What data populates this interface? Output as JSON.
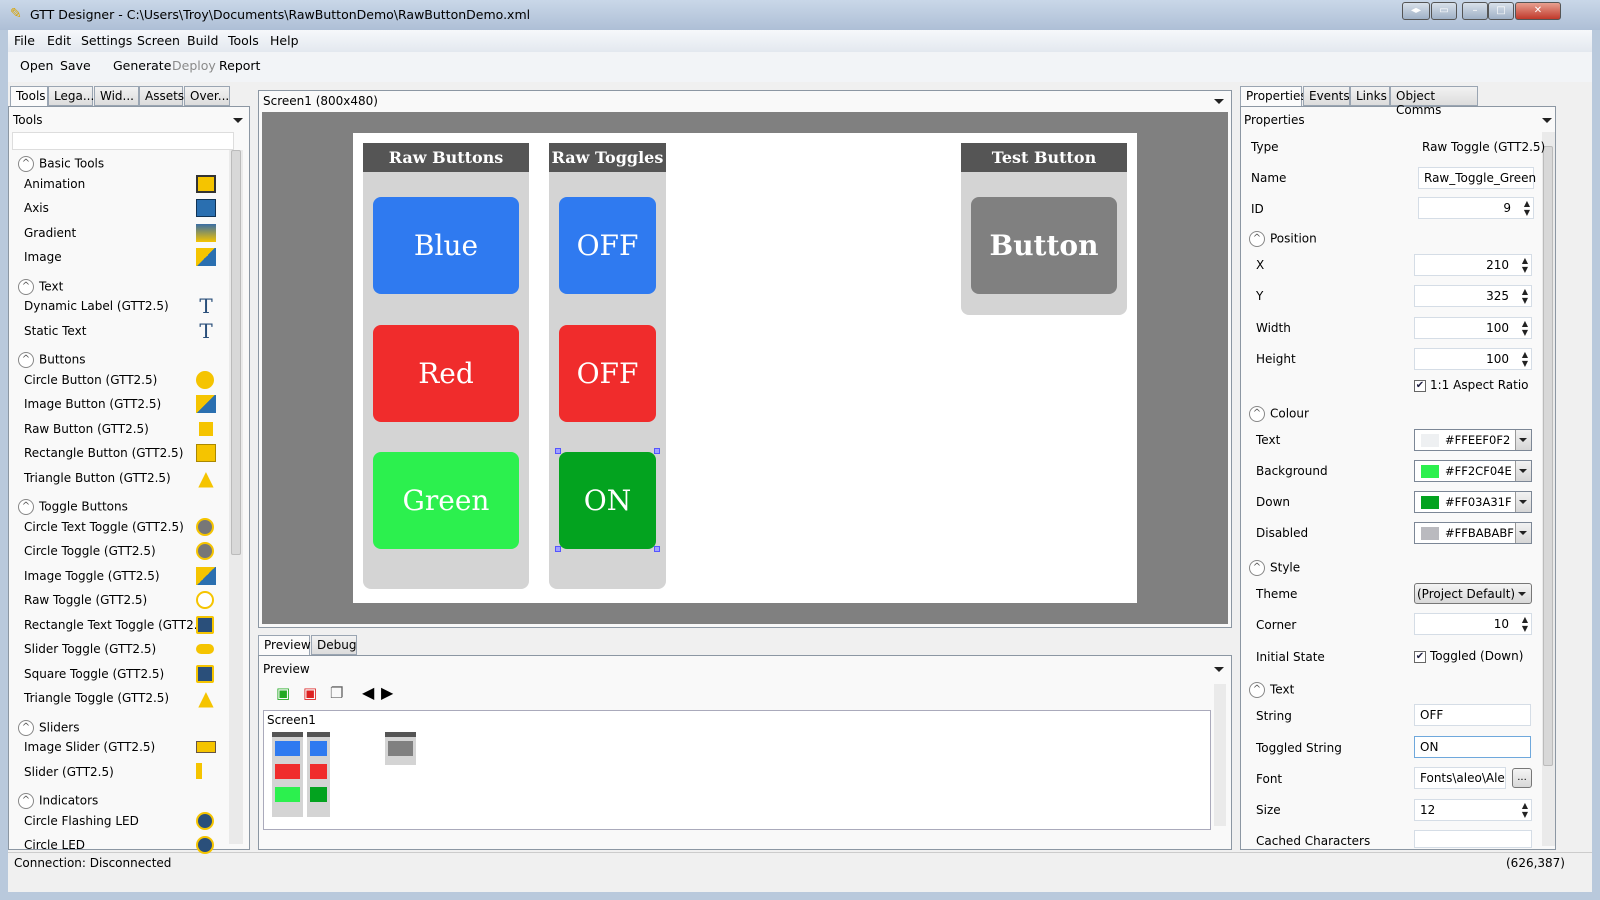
{
  "window": {
    "title": "GTT Designer - C:\\Users\\Troy\\Documents\\RawButtonDemo\\RawButtonDemo.xml"
  },
  "menu": [
    "File",
    "Edit",
    "Settings",
    "Screen",
    "Build",
    "Tools",
    "Help"
  ],
  "toolbar": {
    "open": "Open",
    "save": "Save",
    "generate": "Generate",
    "deploy": "Deploy",
    "report": "Report"
  },
  "left": {
    "tabs": [
      "Tools",
      "Lega...",
      "Wid...",
      "Assets",
      "Over..."
    ],
    "dropdown": "Tools",
    "groups": [
      {
        "label": "Basic Tools",
        "items": [
          {
            "label": "Animation",
            "icon": "animation-icon"
          },
          {
            "label": "Axis",
            "icon": "axis-icon"
          },
          {
            "label": "Gradient",
            "icon": "gradient-icon"
          },
          {
            "label": "Image",
            "icon": "image-icon"
          }
        ]
      },
      {
        "label": "Text",
        "items": [
          {
            "label": "Dynamic Label (GTT2.5)",
            "icon": "dynamic-text-icon"
          },
          {
            "label": "Static Text",
            "icon": "static-text-icon"
          }
        ]
      },
      {
        "label": "Buttons",
        "items": [
          {
            "label": "Circle Button (GTT2.5)",
            "icon": "circle-icon"
          },
          {
            "label": "Image Button (GTT2.5)",
            "icon": "image-icon"
          },
          {
            "label": "Raw Button (GTT2.5)",
            "icon": "raw-button-icon"
          },
          {
            "label": "Rectangle Button (GTT2.5)",
            "icon": "rectangle-icon"
          },
          {
            "label": "Triangle Button (GTT2.5)",
            "icon": "triangle-icon"
          }
        ]
      },
      {
        "label": "Toggle Buttons",
        "items": [
          {
            "label": "Circle Text Toggle (GTT2.5)",
            "icon": "circle-text-toggle-icon"
          },
          {
            "label": "Circle Toggle (GTT2.5)",
            "icon": "circle-toggle-icon"
          },
          {
            "label": "Image Toggle (GTT2.5)",
            "icon": "image-icon"
          },
          {
            "label": "Raw Toggle (GTT2.5)",
            "icon": "raw-toggle-icon"
          },
          {
            "label": "Rectangle Text Toggle (GTT2.5)",
            "icon": "rect-text-toggle-icon"
          },
          {
            "label": "Slider Toggle (GTT2.5)",
            "icon": "slider-toggle-icon"
          },
          {
            "label": "Square Toggle (GTT2.5)",
            "icon": "square-toggle-icon"
          },
          {
            "label": "Triangle Toggle (GTT2.5)",
            "icon": "triangle-toggle-icon"
          }
        ]
      },
      {
        "label": "Sliders",
        "items": [
          {
            "label": "Image Slider (GTT2.5)",
            "icon": "image-slider-icon"
          },
          {
            "label": "Slider (GTT2.5)",
            "icon": "slider-icon"
          }
        ]
      },
      {
        "label": "Indicators",
        "items": [
          {
            "label": "Circle Flashing LED",
            "icon": "flashing-led-icon"
          },
          {
            "label": "Circle LED",
            "icon": "led-icon"
          }
        ]
      }
    ]
  },
  "screen": {
    "title": "Screen1 (800x480)",
    "raw_buttons": {
      "header": "Raw Buttons",
      "buttons": [
        {
          "label": "Blue",
          "color": "#2F7AF0"
        },
        {
          "label": "Red",
          "color": "#F02C2C"
        },
        {
          "label": "Green",
          "color": "#2CF04E"
        }
      ]
    },
    "raw_toggles": {
      "header": "Raw Toggles",
      "buttons": [
        {
          "label": "OFF",
          "color": "#2F7AF0"
        },
        {
          "label": "OFF",
          "color": "#F02C2C"
        },
        {
          "label": "ON",
          "color": "#03A31F"
        }
      ]
    },
    "test": {
      "header": "Test Button",
      "button": "Button",
      "color": "#808080"
    }
  },
  "bottom": {
    "tabs": [
      "Preview",
      "Debug"
    ],
    "dropdown": "Preview",
    "screen_label": "Screen1"
  },
  "right": {
    "tabs": [
      "Properties",
      "Events",
      "Links",
      "Object Comms"
    ],
    "dropdown": "Properties",
    "type_label": "Type",
    "type": "Raw Toggle (GTT2.5)",
    "name_label": "Name",
    "name": "Raw_Toggle_Green",
    "id_label": "ID",
    "id": "9",
    "position": {
      "label": "Position",
      "x_label": "X",
      "x": "210",
      "y_label": "Y",
      "y": "325",
      "w_label": "Width",
      "w": "100",
      "h_label": "Height",
      "h": "100",
      "aspect": "1:1 Aspect Ratio"
    },
    "colour": {
      "label": "Colour",
      "items": [
        {
          "label": "Text",
          "value": "#FFEEF0F2",
          "swatch": "#EEF0F2"
        },
        {
          "label": "Background",
          "value": "#FF2CF04E",
          "swatch": "#2CF04E"
        },
        {
          "label": "Down",
          "value": "#FF03A31F",
          "swatch": "#03A31F"
        },
        {
          "label": "Disabled",
          "value": "#FFBABABF",
          "swatch": "#BABABF"
        }
      ]
    },
    "style": {
      "label": "Style",
      "theme_label": "Theme",
      "theme": "(Project Default)",
      "corner_label": "Corner",
      "corner": "10",
      "initial_label": "Initial State",
      "initial": "Toggled (Down)"
    },
    "text": {
      "label": "Text",
      "string_label": "String",
      "string": "OFF",
      "toggled_label": "Toggled String",
      "toggled": "ON",
      "font_label": "Font",
      "font": "Fonts\\aleo\\Aleo-",
      "size_label": "Size",
      "size": "12",
      "cached_label": "Cached Characters",
      "browse": "..."
    }
  },
  "status": {
    "connection": "Connection: Disconnected",
    "coords": "(626,387)"
  }
}
